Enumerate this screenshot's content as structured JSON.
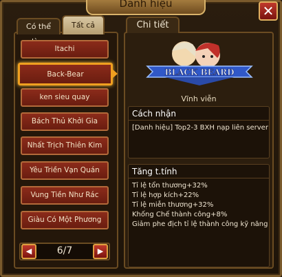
{
  "window": {
    "title": "Danh hiệu",
    "close_label": "✕"
  },
  "tabs": {
    "available": "Có thể dùng",
    "all": "Tất cả"
  },
  "titles": [
    "Itachi",
    "Back-Bear",
    "ken sieu quay",
    "Bách Thủ Khởi Gia",
    "Nhất Trịch Thiên Kim",
    "Yêu Triền Vạn Quán",
    "Vung Tiền Như Rác",
    "Giàu Có Một Phương"
  ],
  "selected_index": 1,
  "pager": {
    "text": "6/7",
    "prev_label": "◀",
    "next_label": "▶"
  },
  "detail": {
    "tab_label": "Chi tiết",
    "banner_text": "BLACK BEARD",
    "duration": "Vĩnh viễn",
    "obtain": {
      "header": "Cách nhận",
      "text": "[Danh hiệu] Top2-3 BXH nạp liên server"
    },
    "stats": {
      "header": "Tăng t.tính",
      "lines": [
        "Tỉ lệ tổn thương+32%",
        "Tỉ lệ hợp kích+22%",
        "Tỉ lệ miễn thương+32%",
        "Khống Chế thành công+8%",
        "Giảm phe địch tỉ lệ thành công kỹ năng"
      ]
    }
  },
  "colors": {
    "accent": "#f0a020",
    "item_bg": "#7a2414",
    "panel_bg": "#2c1e0e"
  }
}
